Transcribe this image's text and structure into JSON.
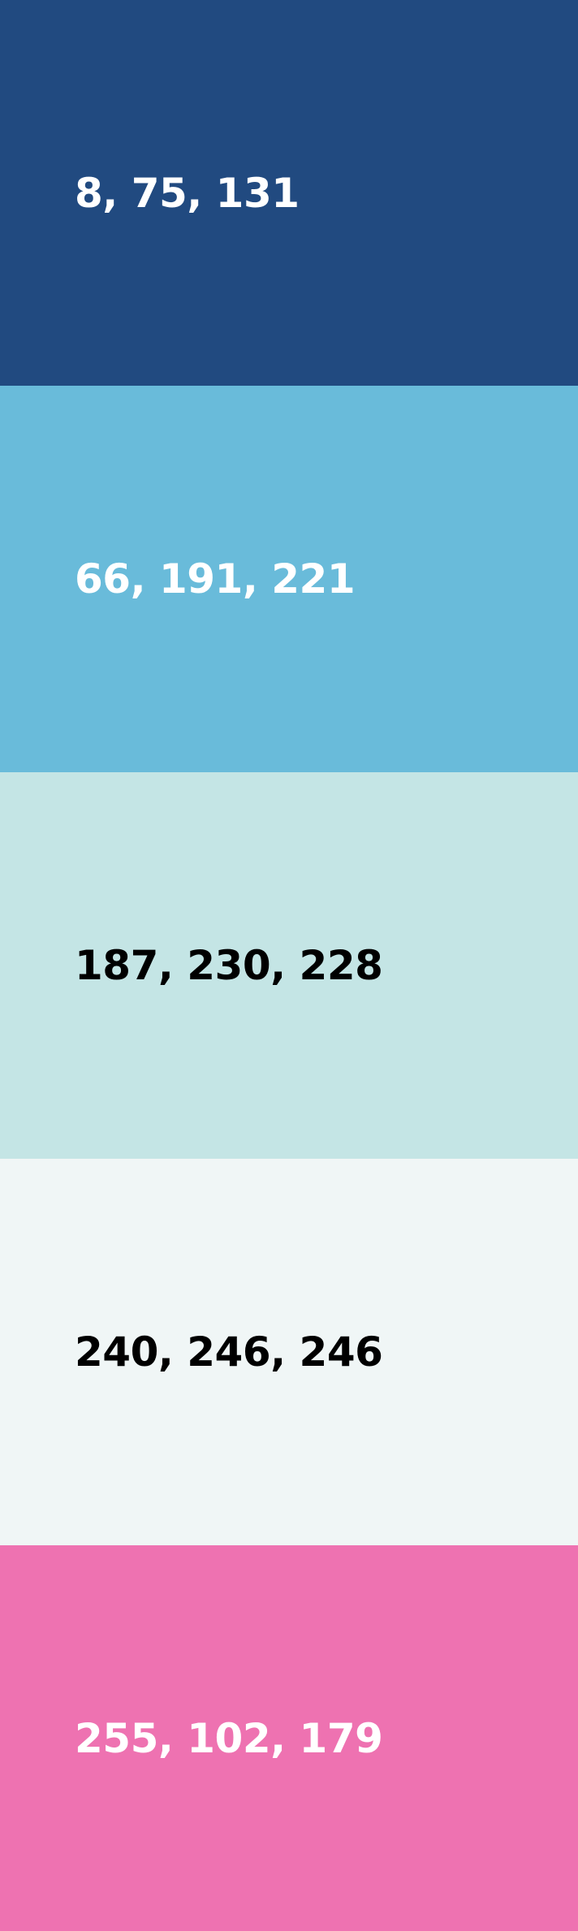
{
  "swatches": [
    {
      "label": "8, 75, 131",
      "bg": "#214a80",
      "text_color": "#ffffff"
    },
    {
      "label": "66, 191, 221",
      "bg": "#69bbda",
      "text_color": "#ffffff"
    },
    {
      "label": "187, 230, 228",
      "bg": "#c4e5e5",
      "text_color": "#000000"
    },
    {
      "label": "240, 246, 246",
      "bg": "#f0f6f6",
      "text_color": "#000000"
    },
    {
      "label": "255, 102, 179",
      "bg": "#ee72b1",
      "text_color": "#ffffff"
    }
  ]
}
